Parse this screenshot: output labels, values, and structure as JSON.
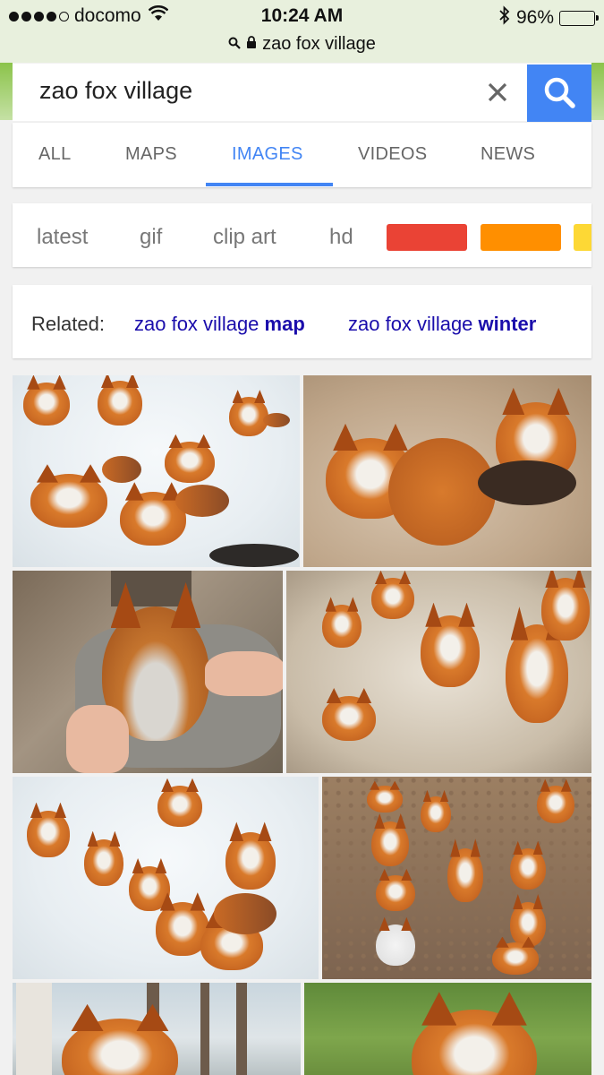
{
  "status_bar": {
    "carrier": "docomo",
    "time": "10:24 AM",
    "battery": "96%",
    "url": "zao fox village"
  },
  "search": {
    "query": "zao fox village"
  },
  "tabs": [
    {
      "label": "ALL"
    },
    {
      "label": "MAPS"
    },
    {
      "label": "IMAGES",
      "active": true
    },
    {
      "label": "VIDEOS"
    },
    {
      "label": "NEWS"
    }
  ],
  "chips": {
    "items": [
      "latest",
      "gif",
      "clip art",
      "hd"
    ],
    "colors": [
      "#ea4335",
      "#ff8f00",
      "#fdd835"
    ]
  },
  "related": {
    "label": "Related:",
    "links": [
      {
        "prefix": "zao fox village ",
        "bold": "map"
      },
      {
        "prefix": "zao fox village ",
        "bold": "winter"
      }
    ]
  },
  "colors": {
    "accent": "#4285f4",
    "link": "#1a0dab"
  }
}
